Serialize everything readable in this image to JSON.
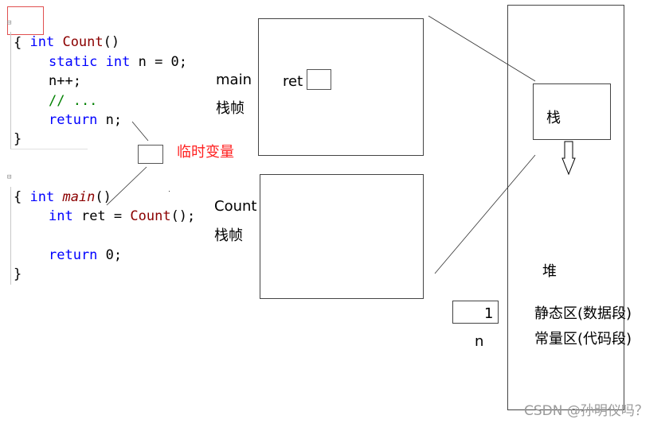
{
  "code": {
    "count_func": {
      "signature": {
        "kw": "int",
        "name": "Count",
        "rest": "()"
      },
      "open_brace": "{",
      "lines": [
        {
          "parts": [
            {
              "t": "static int",
              "c": "kw"
            },
            {
              "t": " n = 0;",
              "c": "tx"
            }
          ]
        },
        {
          "parts": [
            {
              "t": "n++;",
              "c": "tx"
            }
          ]
        },
        {
          "parts": [
            {
              "t": "// ...",
              "c": "cm"
            }
          ]
        },
        {
          "parts": [
            {
              "t": "return",
              "c": "kw"
            },
            {
              "t": " n;",
              "c": "tx"
            }
          ]
        }
      ],
      "close_brace": "}"
    },
    "main_func": {
      "signature": {
        "kw": "int",
        "name": "main",
        "rest": "()"
      },
      "open_brace": "{",
      "line1": {
        "kw": "int",
        "var": " ret = ",
        "call": "Count",
        "rest": "();"
      },
      "line2": {
        "kw": "return",
        "rest": " 0;"
      },
      "close_brace": "}"
    }
  },
  "labels": {
    "temp_variable": "临时变量",
    "main_frame_name": "main",
    "main_frame_suffix": "栈帧",
    "ret_label": "ret",
    "count_frame_name": "Count",
    "count_frame_suffix": "栈帧",
    "stack": "栈",
    "heap": "堆",
    "static_area": "静态区(数据段)",
    "const_area": "常量区(代码段)",
    "n_value": "1",
    "n_label": "n"
  },
  "watermark": "CSDN @孙明仪吗？",
  "colors": {
    "keyword": "#0000ff",
    "function": "#8b0000",
    "comment": "#008000",
    "annotation_red": "#ff2020",
    "highlight_border": "#e05050"
  }
}
